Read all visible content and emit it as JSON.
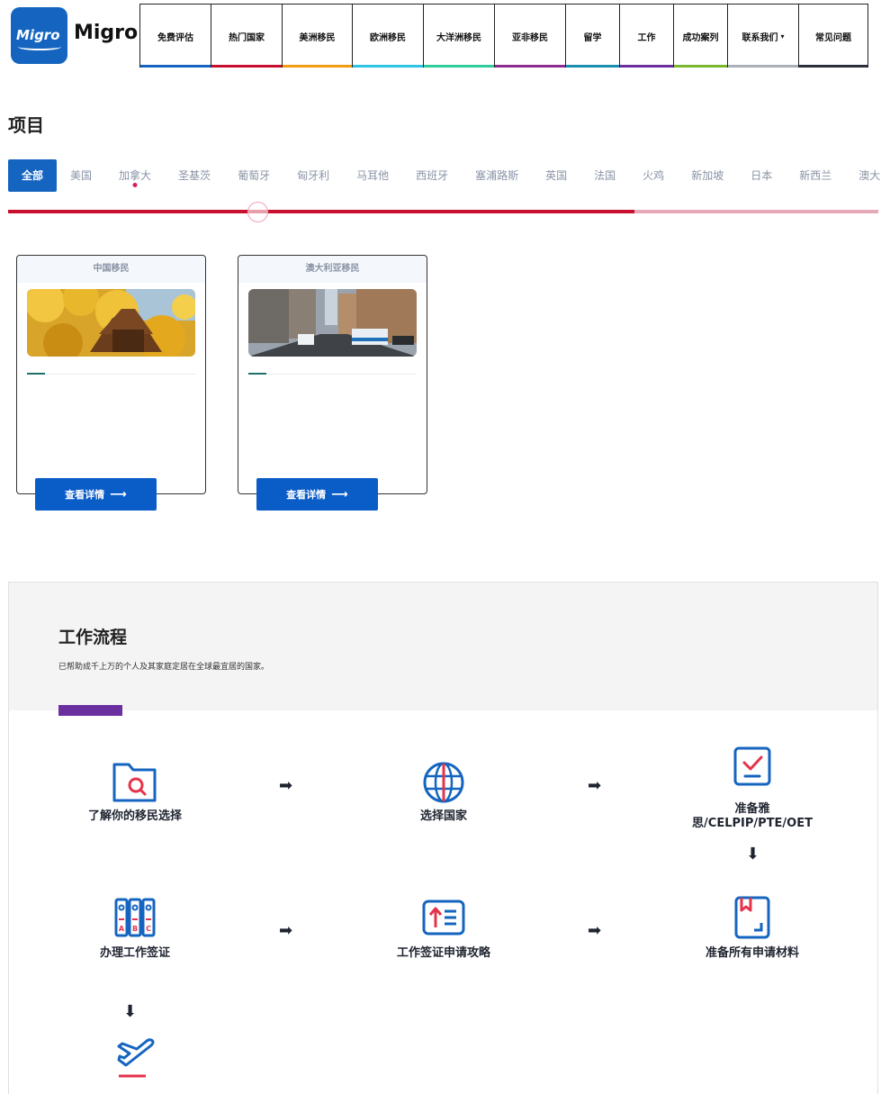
{
  "brand": {
    "logo_text": "Migro",
    "name": "Migro",
    "logo_color": "#1565c0"
  },
  "nav": [
    {
      "label": "免费评估",
      "color": "#1565c0",
      "width": 79
    },
    {
      "label": "热门国家",
      "color": "#c8102e",
      "width": 79
    },
    {
      "label": "美洲移民",
      "color": "#f39c12",
      "width": 78
    },
    {
      "label": "欧洲移民",
      "color": "#2ec4e6",
      "width": 79
    },
    {
      "label": "大洋洲移民",
      "color": "#2ecc9a",
      "width": 79
    },
    {
      "label": "亚非移民",
      "color": "#8e2c8f",
      "width": 79
    },
    {
      "label": "留学",
      "color": "#1a8fb0",
      "width": 60
    },
    {
      "label": "工作",
      "color": "#6b2fa0",
      "width": 60
    },
    {
      "label": "成功案列",
      "color": "#7cb82f",
      "width": 60
    },
    {
      "label": "联系我们",
      "color": "#aab0b8",
      "width": 79,
      "has_dropdown": true
    },
    {
      "label": "常见问题",
      "color": "#2a2f3a",
      "width": 78
    }
  ],
  "projects": {
    "title": "项目",
    "filters": [
      "全部",
      "美国",
      "加拿大",
      "圣基茨",
      "葡萄牙",
      "匈牙利",
      "马耳他",
      "西班牙",
      "塞浦路斯",
      "英国",
      "法国",
      "火鸡",
      "新加坡",
      "日本",
      "新西兰",
      "澳大"
    ],
    "active_filter": "全部",
    "scroll_progress": 0.72,
    "cards": [
      {
        "title": "中国移民",
        "image": "golden-ginkgo-pagoda",
        "button": "查看详情"
      },
      {
        "title": "澳大利亚移民",
        "image": "sydney-street-bus",
        "button": "查看详情"
      }
    ]
  },
  "workflow": {
    "title": "工作流程",
    "subtitle": "已帮助成千上万的个人及其家庭定居在全球最宜居的国家。",
    "accent_color": "#6b2fa0",
    "steps": [
      {
        "label": "了解你的移民选择",
        "icon": "folder-search-icon"
      },
      {
        "label": "选择国家",
        "icon": "globe-icon"
      },
      {
        "label": "准备雅\n思/CELPIP/PTE/OET",
        "icon": "checklist-icon"
      },
      {
        "label": "准备所有申请材料",
        "icon": "bookmark-document-icon"
      },
      {
        "label": "工作签证申请攻略",
        "icon": "upload-list-icon"
      },
      {
        "label": "办理工作签证",
        "icon": "binders-abc-icon"
      },
      {
        "label": "",
        "icon": "flight-departure-icon"
      }
    ]
  }
}
